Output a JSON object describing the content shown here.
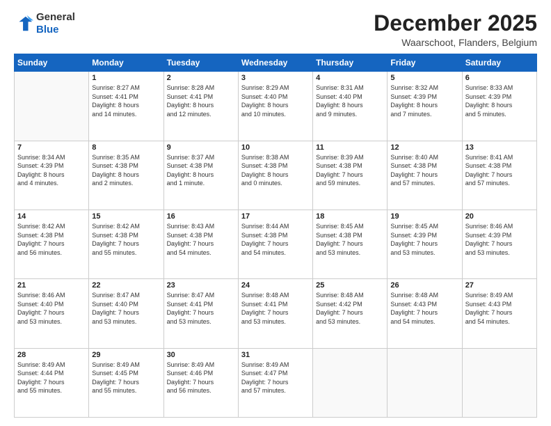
{
  "header": {
    "logo": {
      "line1": "General",
      "line2": "Blue"
    },
    "title": "December 2025",
    "location": "Waarschoot, Flanders, Belgium"
  },
  "days_of_week": [
    "Sunday",
    "Monday",
    "Tuesday",
    "Wednesday",
    "Thursday",
    "Friday",
    "Saturday"
  ],
  "weeks": [
    [
      {
        "day": "",
        "content": ""
      },
      {
        "day": "1",
        "content": "Sunrise: 8:27 AM\nSunset: 4:41 PM\nDaylight: 8 hours\nand 14 minutes."
      },
      {
        "day": "2",
        "content": "Sunrise: 8:28 AM\nSunset: 4:41 PM\nDaylight: 8 hours\nand 12 minutes."
      },
      {
        "day": "3",
        "content": "Sunrise: 8:29 AM\nSunset: 4:40 PM\nDaylight: 8 hours\nand 10 minutes."
      },
      {
        "day": "4",
        "content": "Sunrise: 8:31 AM\nSunset: 4:40 PM\nDaylight: 8 hours\nand 9 minutes."
      },
      {
        "day": "5",
        "content": "Sunrise: 8:32 AM\nSunset: 4:39 PM\nDaylight: 8 hours\nand 7 minutes."
      },
      {
        "day": "6",
        "content": "Sunrise: 8:33 AM\nSunset: 4:39 PM\nDaylight: 8 hours\nand 5 minutes."
      }
    ],
    [
      {
        "day": "7",
        "content": "Sunrise: 8:34 AM\nSunset: 4:39 PM\nDaylight: 8 hours\nand 4 minutes."
      },
      {
        "day": "8",
        "content": "Sunrise: 8:35 AM\nSunset: 4:38 PM\nDaylight: 8 hours\nand 2 minutes."
      },
      {
        "day": "9",
        "content": "Sunrise: 8:37 AM\nSunset: 4:38 PM\nDaylight: 8 hours\nand 1 minute."
      },
      {
        "day": "10",
        "content": "Sunrise: 8:38 AM\nSunset: 4:38 PM\nDaylight: 8 hours\nand 0 minutes."
      },
      {
        "day": "11",
        "content": "Sunrise: 8:39 AM\nSunset: 4:38 PM\nDaylight: 7 hours\nand 59 minutes."
      },
      {
        "day": "12",
        "content": "Sunrise: 8:40 AM\nSunset: 4:38 PM\nDaylight: 7 hours\nand 57 minutes."
      },
      {
        "day": "13",
        "content": "Sunrise: 8:41 AM\nSunset: 4:38 PM\nDaylight: 7 hours\nand 57 minutes."
      }
    ],
    [
      {
        "day": "14",
        "content": "Sunrise: 8:42 AM\nSunset: 4:38 PM\nDaylight: 7 hours\nand 56 minutes."
      },
      {
        "day": "15",
        "content": "Sunrise: 8:42 AM\nSunset: 4:38 PM\nDaylight: 7 hours\nand 55 minutes."
      },
      {
        "day": "16",
        "content": "Sunrise: 8:43 AM\nSunset: 4:38 PM\nDaylight: 7 hours\nand 54 minutes."
      },
      {
        "day": "17",
        "content": "Sunrise: 8:44 AM\nSunset: 4:38 PM\nDaylight: 7 hours\nand 54 minutes."
      },
      {
        "day": "18",
        "content": "Sunrise: 8:45 AM\nSunset: 4:38 PM\nDaylight: 7 hours\nand 53 minutes."
      },
      {
        "day": "19",
        "content": "Sunrise: 8:45 AM\nSunset: 4:39 PM\nDaylight: 7 hours\nand 53 minutes."
      },
      {
        "day": "20",
        "content": "Sunrise: 8:46 AM\nSunset: 4:39 PM\nDaylight: 7 hours\nand 53 minutes."
      }
    ],
    [
      {
        "day": "21",
        "content": "Sunrise: 8:46 AM\nSunset: 4:40 PM\nDaylight: 7 hours\nand 53 minutes."
      },
      {
        "day": "22",
        "content": "Sunrise: 8:47 AM\nSunset: 4:40 PM\nDaylight: 7 hours\nand 53 minutes."
      },
      {
        "day": "23",
        "content": "Sunrise: 8:47 AM\nSunset: 4:41 PM\nDaylight: 7 hours\nand 53 minutes."
      },
      {
        "day": "24",
        "content": "Sunrise: 8:48 AM\nSunset: 4:41 PM\nDaylight: 7 hours\nand 53 minutes."
      },
      {
        "day": "25",
        "content": "Sunrise: 8:48 AM\nSunset: 4:42 PM\nDaylight: 7 hours\nand 53 minutes."
      },
      {
        "day": "26",
        "content": "Sunrise: 8:48 AM\nSunset: 4:43 PM\nDaylight: 7 hours\nand 54 minutes."
      },
      {
        "day": "27",
        "content": "Sunrise: 8:49 AM\nSunset: 4:43 PM\nDaylight: 7 hours\nand 54 minutes."
      }
    ],
    [
      {
        "day": "28",
        "content": "Sunrise: 8:49 AM\nSunset: 4:44 PM\nDaylight: 7 hours\nand 55 minutes."
      },
      {
        "day": "29",
        "content": "Sunrise: 8:49 AM\nSunset: 4:45 PM\nDaylight: 7 hours\nand 55 minutes."
      },
      {
        "day": "30",
        "content": "Sunrise: 8:49 AM\nSunset: 4:46 PM\nDaylight: 7 hours\nand 56 minutes."
      },
      {
        "day": "31",
        "content": "Sunrise: 8:49 AM\nSunset: 4:47 PM\nDaylight: 7 hours\nand 57 minutes."
      },
      {
        "day": "",
        "content": ""
      },
      {
        "day": "",
        "content": ""
      },
      {
        "day": "",
        "content": ""
      }
    ]
  ]
}
